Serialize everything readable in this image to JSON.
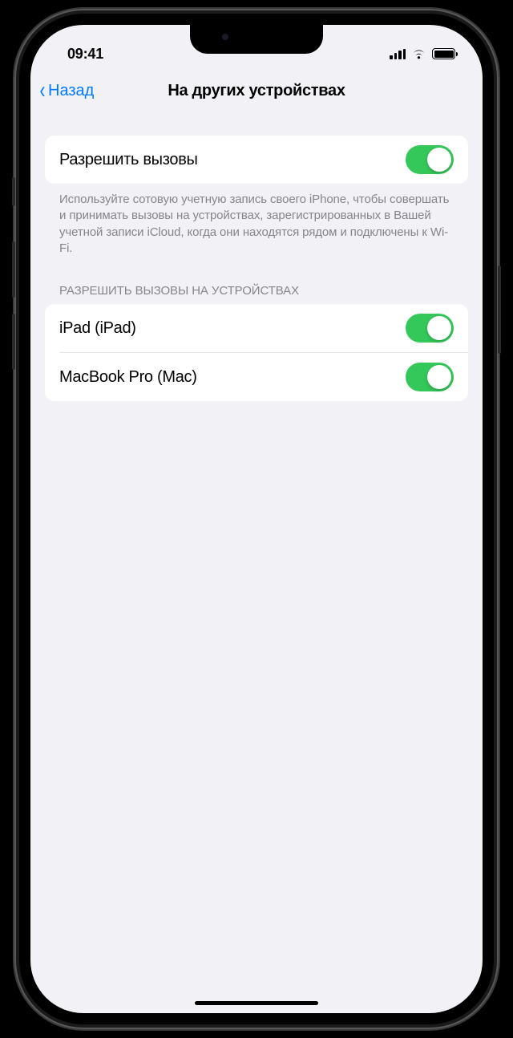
{
  "statusBar": {
    "time": "09:41"
  },
  "nav": {
    "back": "Назад",
    "title": "На других устройствах"
  },
  "allowCalls": {
    "label": "Разрешить вызовы",
    "footer": "Используйте сотовую учетную запись своего iPhone, чтобы совершать и принимать вызовы на устройствах, зарегистрированных в Вашей учетной записи iCloud, когда они находятся рядом и подключены к Wi-Fi.",
    "enabled": true
  },
  "devicesSection": {
    "header": "РАЗРЕШИТЬ ВЫЗОВЫ НА УСТРОЙСТВАХ",
    "devices": [
      {
        "label": "iPad (iPad)",
        "enabled": true
      },
      {
        "label": "MacBook Pro (Mac)",
        "enabled": true
      }
    ]
  }
}
